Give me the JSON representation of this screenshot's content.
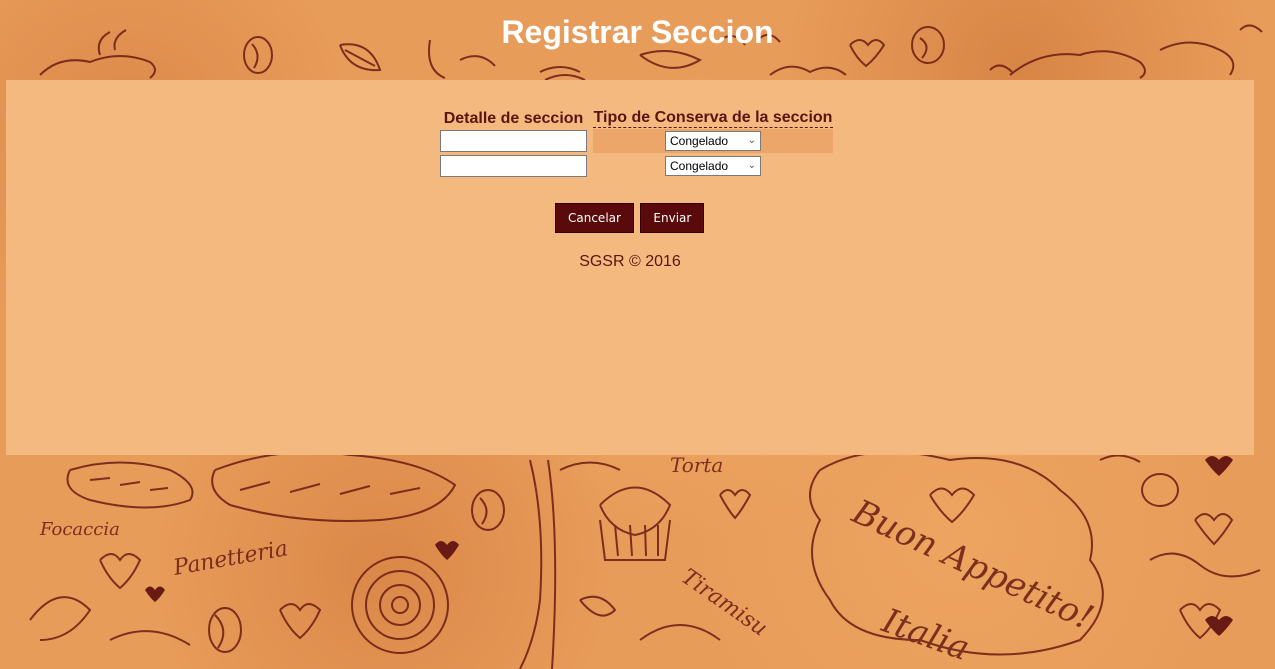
{
  "page": {
    "title": "Registrar Seccion"
  },
  "table": {
    "headers": [
      "Detalle de seccion",
      "Tipo de Conserva de la seccion"
    ],
    "rows": [
      {
        "detalle": "",
        "tipo": "Congelado"
      },
      {
        "detalle": "",
        "tipo": "Congelado"
      }
    ]
  },
  "buttons": {
    "cancel": "Cancelar",
    "submit": "Enviar"
  },
  "footer": {
    "text": "SGSR © 2016"
  },
  "colors": {
    "accent": "#5a0a0a",
    "panel": "#f3b97f",
    "background": "#e89c5a",
    "text": "#5a1512"
  }
}
